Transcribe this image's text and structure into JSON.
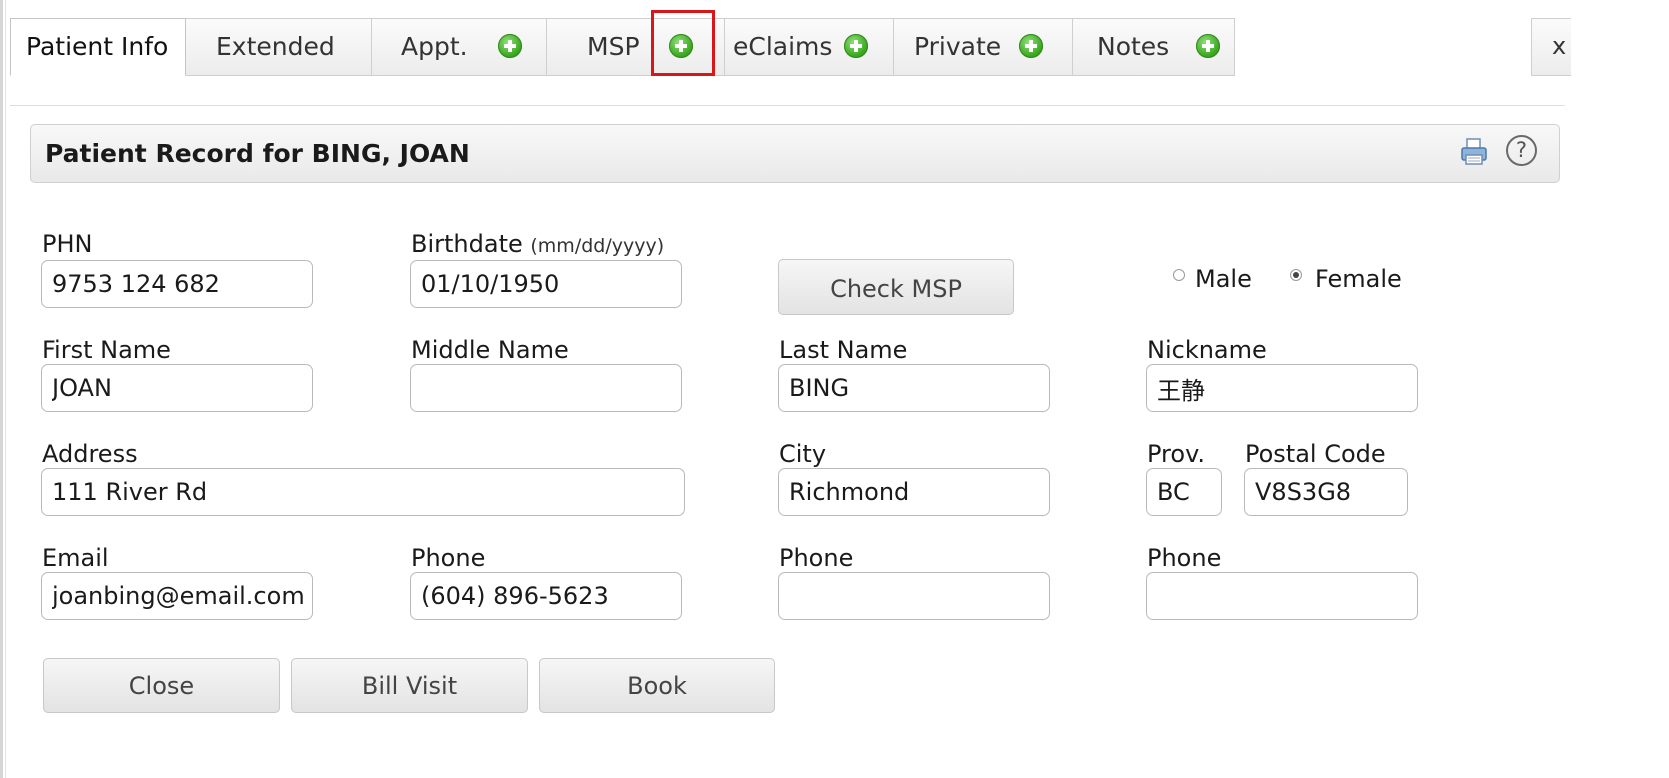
{
  "tabs": [
    {
      "label": "Patient Info",
      "active": true
    },
    {
      "label": "Extended"
    },
    {
      "label": "Appt."
    },
    {
      "label": "MSP"
    },
    {
      "label": "eClaims"
    },
    {
      "label": "Private"
    },
    {
      "label": "Notes"
    }
  ],
  "close_tab_label": "x",
  "panel": {
    "title": "Patient Record for BING, JOAN"
  },
  "form": {
    "phn": {
      "label": "PHN",
      "value": "9753 124 682"
    },
    "birthdate": {
      "label": "Birthdate",
      "hint": "(mm/dd/yyyy)",
      "value": "01/10/1950"
    },
    "check_msp_label": "Check MSP",
    "gender": {
      "male_label": "Male",
      "female_label": "Female",
      "selected": "Female"
    },
    "first_name": {
      "label": "First Name",
      "value": "JOAN"
    },
    "middle_name": {
      "label": "Middle Name",
      "value": ""
    },
    "last_name": {
      "label": "Last Name",
      "value": "BING"
    },
    "nickname": {
      "label": "Nickname",
      "value": "王静"
    },
    "address": {
      "label": "Address",
      "value": "111 River Rd"
    },
    "city": {
      "label": "City",
      "value": "Richmond"
    },
    "prov": {
      "label": "Prov.",
      "value": "BC"
    },
    "postal_code": {
      "label": "Postal Code",
      "value": "V8S3G8"
    },
    "email": {
      "label": "Email",
      "value": "joanbing@email.com"
    },
    "phone1": {
      "label": "Phone",
      "value": "(604) 896-5623"
    },
    "phone2": {
      "label": "Phone",
      "value": ""
    },
    "phone3": {
      "label": "Phone",
      "value": ""
    }
  },
  "buttons": {
    "close": "Close",
    "bill_visit": "Bill Visit",
    "book": "Book"
  },
  "icons": {
    "add_tab": "plus-circle-icon",
    "print": "print-icon",
    "help": "help-icon"
  },
  "colors": {
    "add_icon_green": "#3aa61f",
    "highlight_red": "#d9161a"
  }
}
